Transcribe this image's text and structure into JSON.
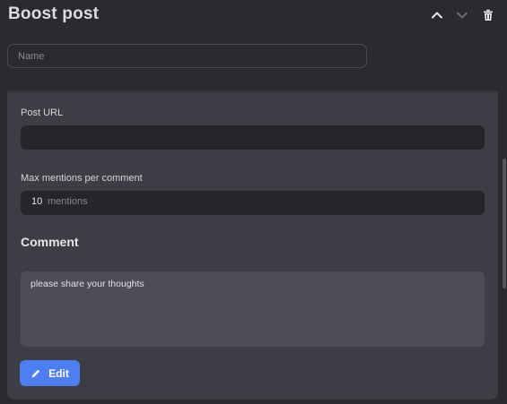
{
  "header": {
    "title": "Boost post",
    "icons": {
      "move_up": "chevron-up-icon",
      "move_down": "chevron-down-icon",
      "delete": "trash-icon"
    }
  },
  "name_field": {
    "placeholder": "Name",
    "value": ""
  },
  "form": {
    "post_url": {
      "label": "Post URL",
      "value": ""
    },
    "max_mentions": {
      "label": "Max mentions per comment",
      "value": "10",
      "unit": "mentions"
    },
    "comment": {
      "heading": "Comment",
      "text": "please share your thoughts"
    },
    "edit_button": {
      "label": "Edit",
      "icon": "pencil-icon"
    }
  },
  "colors": {
    "accent": "#4f7ef0",
    "background": "#2a2b30",
    "panel": "#3c3d45",
    "input": "#25262b"
  }
}
